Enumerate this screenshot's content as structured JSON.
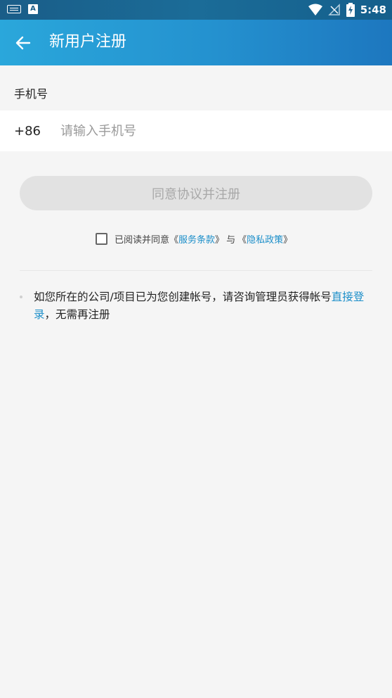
{
  "statusbar": {
    "time": "5:48",
    "icons": [
      "keyboard-icon",
      "a-icon",
      "wifi-icon",
      "no-signal-icon",
      "battery-charging-icon"
    ],
    "a_label": "A"
  },
  "appbar": {
    "back_icon": "arrow-left-icon",
    "title": "新用户注册"
  },
  "form": {
    "phone_label": "手机号",
    "country_code": "+86",
    "phone_value": "",
    "phone_placeholder": "请输入手机号",
    "submit_label": "同意协议并注册",
    "agreement": {
      "checked": false,
      "prefix": "已阅读并同意",
      "terms_open": "《",
      "terms": "服务条款",
      "terms_close": "》",
      "and": "与",
      "privacy_open": "《",
      "privacy": "隐私政策",
      "privacy_close": "》"
    }
  },
  "note": {
    "text": "如您所在的公司/项目已为您创建帐号，请咨询管理员获得帐号",
    "link": "直接登录",
    "suffix": "，无需再注册"
  },
  "colors": {
    "appbar_start": "#2aa7db",
    "appbar_end": "#1d77bf",
    "link": "#1b8ec9",
    "button_disabled_bg": "#e2e2e2",
    "button_disabled_text": "#a8a8a8"
  }
}
